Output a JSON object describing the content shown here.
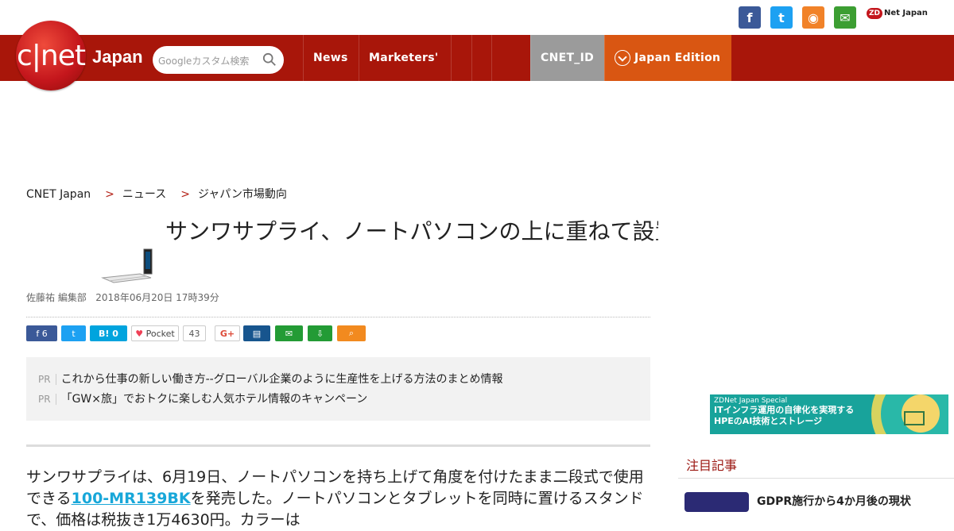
{
  "top": {
    "social": [
      {
        "name": "facebook",
        "label": "f",
        "color": "#3b5998"
      },
      {
        "name": "twitter",
        "label": "t",
        "color": "#1da1f2"
      },
      {
        "name": "rss",
        "label": "◉",
        "color": "#f18228"
      },
      {
        "name": "mail",
        "label": "✉",
        "color": "#3c9e32"
      }
    ],
    "zdnet_label": "Net Japan",
    "zdnet_badge": "ZD"
  },
  "nav": {
    "logo": "c|net",
    "brand": "Japan",
    "search_placeholder": "Googleカスタム検索",
    "items": [
      "News",
      "Marketers'",
      "",
      "",
      ""
    ],
    "cnet_id": "CNET_ID",
    "edition": "Japan Edition"
  },
  "article": {
    "breadcrumb": [
      "CNET Japan",
      "ニュース",
      "ジャパン市場動向"
    ],
    "title": "サンワサプライ、ノートパソコンの上に重ねて設置できる二段式の台を発売",
    "meta_author": "佐藤祐 編集部",
    "meta_date": "2018年06月20日 17時39分",
    "shares": {
      "facebook_count": "6",
      "hatena": "B!",
      "hatena_count": "0",
      "pocket": "Pocket",
      "pocket_count": "43",
      "googleplus": "G+"
    },
    "pr": [
      {
        "label": "PR",
        "text": "これから仕事の新しい働き方--グローバル企業のように生産性を上げる方法のまとめ情報"
      },
      {
        "label": "PR",
        "text": "「GW×旅」でおトクに楽しむ人気ホテル情報のキャンペーン"
      }
    ],
    "body_prefix": "サンワサプライは、6月19日、ノートパソコンを持ち上げて角度を付けたまま二段式で使用できる",
    "body_link": "100-MR139BK",
    "body_suffix": "を発売した。ノートパソコンとタブレットを同時に置けるスタンドで、価格は税抜き1万4630円。カラーは"
  },
  "sidebar": {
    "ad_small": "ZDNet Japan Special",
    "ad_line1": "ITインフラ運用の自律化を実現する",
    "ad_line2": "HPEのAI技術とストレージ",
    "section_title": "注目記事",
    "first_item": "GDPR施行から4か月後の現状"
  }
}
